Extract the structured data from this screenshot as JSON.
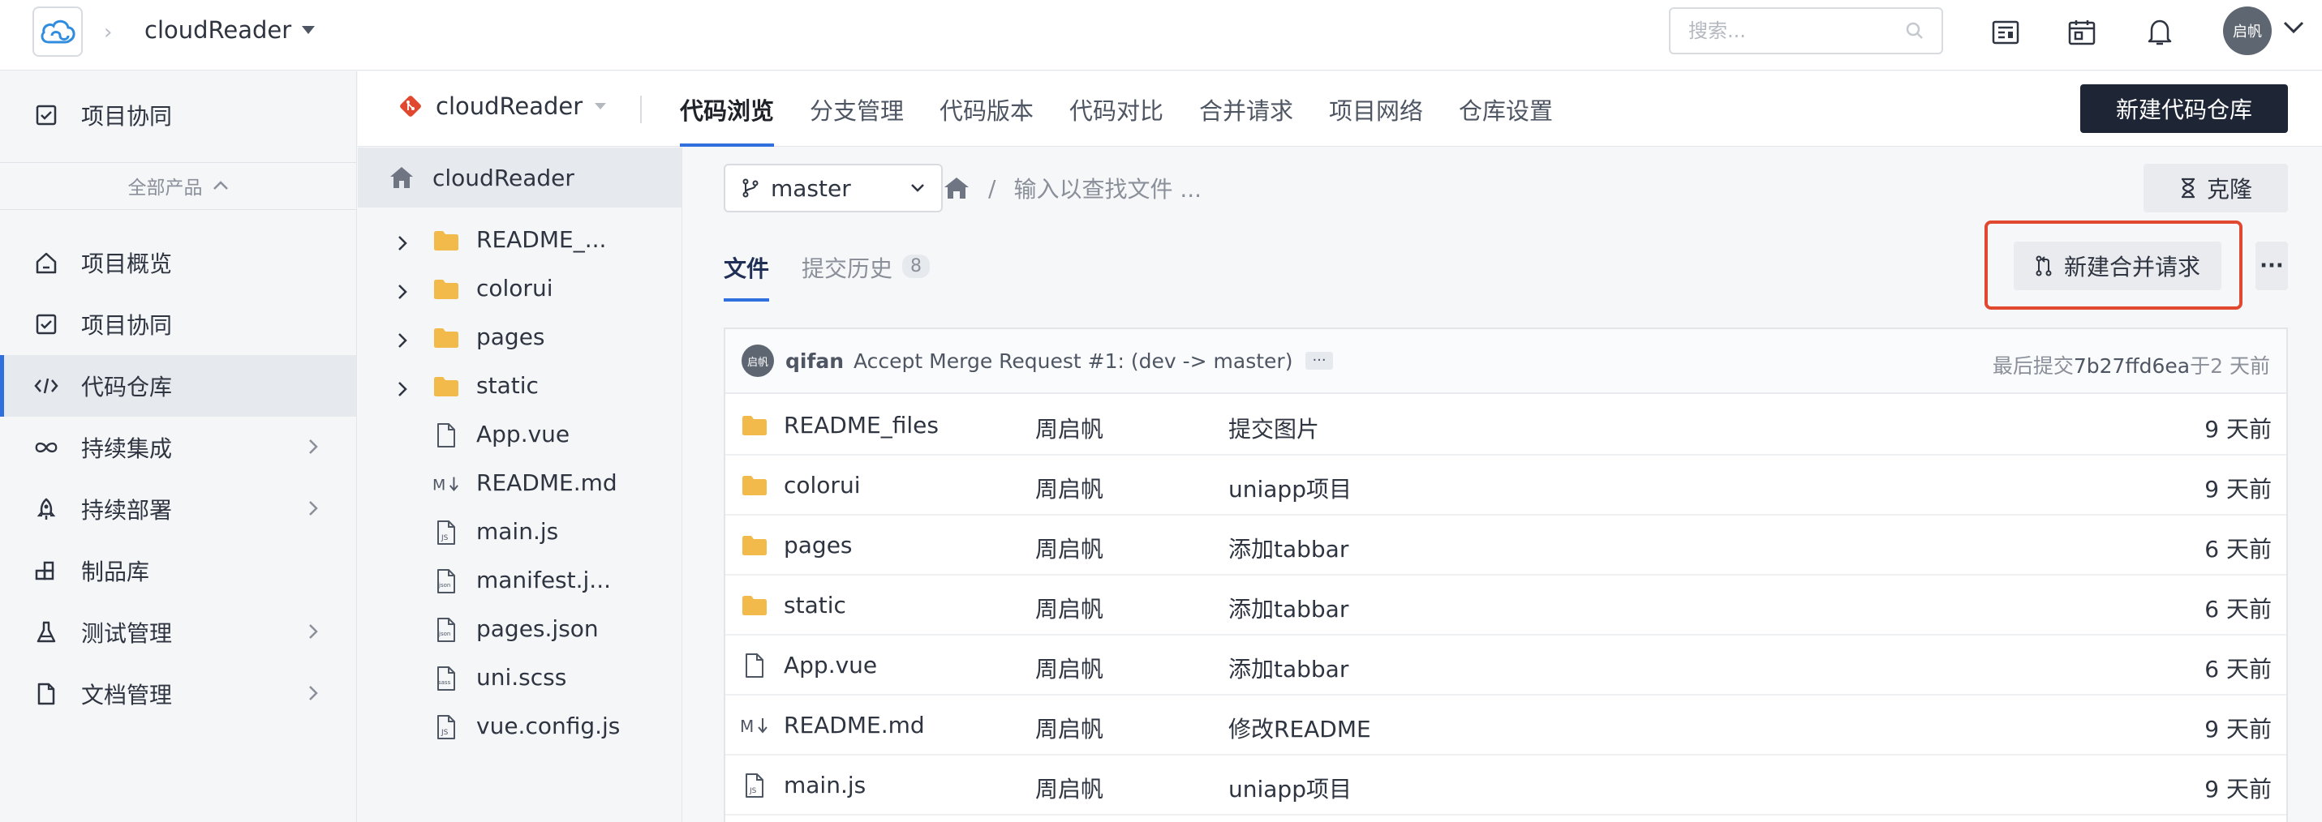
{
  "topbar": {
    "project_name": "cloudReader",
    "search_placeholder": "搜索...",
    "avatar_text": "启帆"
  },
  "sidebar": {
    "pinned": {
      "label": "项目协同",
      "icon": "checkbox-icon"
    },
    "all_products_label": "全部产品",
    "items": [
      {
        "label": "项目概览",
        "icon": "home-icon",
        "has_arrow": false
      },
      {
        "label": "项目协同",
        "icon": "checkbox-icon",
        "has_arrow": false
      },
      {
        "label": "代码仓库",
        "icon": "code-icon",
        "has_arrow": false,
        "active": true
      },
      {
        "label": "持续集成",
        "icon": "infinity-icon",
        "has_arrow": true
      },
      {
        "label": "持续部署",
        "icon": "rocket-icon",
        "has_arrow": true
      },
      {
        "label": "制品库",
        "icon": "blocks-icon",
        "has_arrow": false
      },
      {
        "label": "测试管理",
        "icon": "flask-icon",
        "has_arrow": true
      },
      {
        "label": "文档管理",
        "icon": "document-icon",
        "has_arrow": true
      }
    ]
  },
  "subheader": {
    "repo_name": "cloudReader",
    "tabs": [
      "代码浏览",
      "分支管理",
      "代码版本",
      "代码对比",
      "合并请求",
      "项目网络",
      "仓库设置"
    ],
    "active_tab": 0,
    "new_repo_label": "新建代码仓库"
  },
  "tree": {
    "root": "cloudReader",
    "items": [
      {
        "name": "README_...",
        "type": "folder"
      },
      {
        "name": "colorui",
        "type": "folder"
      },
      {
        "name": "pages",
        "type": "folder"
      },
      {
        "name": "static",
        "type": "folder"
      },
      {
        "name": "App.vue",
        "type": "file"
      },
      {
        "name": "README.md",
        "type": "markdown"
      },
      {
        "name": "main.js",
        "type": "js"
      },
      {
        "name": "manifest.j...",
        "type": "json"
      },
      {
        "name": "pages.json",
        "type": "json"
      },
      {
        "name": "uni.scss",
        "type": "sass"
      },
      {
        "name": "vue.config.js",
        "type": "js"
      }
    ]
  },
  "main": {
    "branch": "master",
    "path_placeholder": "输入以查找文件 ...",
    "path_sep": "/",
    "clone_label": "克隆",
    "tabs": {
      "files": "文件",
      "history": "提交历史",
      "history_count": "8"
    },
    "new_mr_label": "新建合并请求",
    "more_label": "···",
    "commit": {
      "avatar_text": "启帆",
      "author": "qifan",
      "message": "Accept Merge Request #1: (dev -> master)",
      "more": "···",
      "prefix": "最后提交",
      "hash": "7b27ffd6ea",
      "suffix": "于2 天前"
    },
    "files": [
      {
        "name": "README_files",
        "type": "folder",
        "author": "周启帆",
        "commit": "提交图片",
        "time": "9 天前"
      },
      {
        "name": "colorui",
        "type": "folder",
        "author": "周启帆",
        "commit": "uniapp项目",
        "time": "9 天前"
      },
      {
        "name": "pages",
        "type": "folder",
        "author": "周启帆",
        "commit": "添加tabbar",
        "time": "6 天前"
      },
      {
        "name": "static",
        "type": "folder",
        "author": "周启帆",
        "commit": "添加tabbar",
        "time": "6 天前"
      },
      {
        "name": "App.vue",
        "type": "file",
        "author": "周启帆",
        "commit": "添加tabbar",
        "time": "6 天前"
      },
      {
        "name": "README.md",
        "type": "markdown",
        "author": "周启帆",
        "commit": "修改README",
        "time": "9 天前"
      },
      {
        "name": "main.js",
        "type": "js",
        "author": "周启帆",
        "commit": "uniapp项目",
        "time": "9 天前"
      }
    ]
  },
  "colors": {
    "accent": "#2f6fde",
    "highlight": "#e0492f",
    "folder": "#f2b94b",
    "dark_button": "#1e2535"
  }
}
